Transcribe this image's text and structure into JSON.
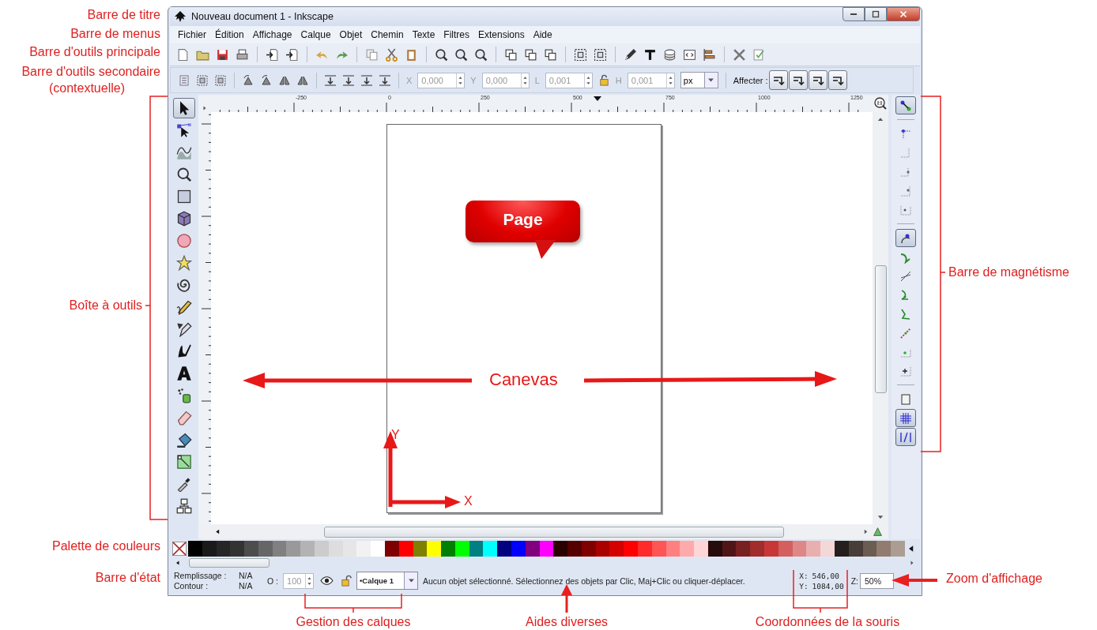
{
  "window": {
    "title": "Nouveau document 1 - Inkscape"
  },
  "menu": [
    {
      "label": "Fichier"
    },
    {
      "label": "Édition"
    },
    {
      "label": "Affichage"
    },
    {
      "label": "Calque"
    },
    {
      "label": "Objet"
    },
    {
      "label": "Chemin"
    },
    {
      "label": "Texte"
    },
    {
      "label": "Filtres"
    },
    {
      "label": "Extensions"
    },
    {
      "label": "Aide"
    }
  ],
  "tool_controls": {
    "fields": [
      {
        "label": "X",
        "value": "0,000",
        "disabled": true
      },
      {
        "label": "Y",
        "value": "0,000",
        "disabled": true
      },
      {
        "label": "L",
        "value": "0,001",
        "disabled": true
      },
      {
        "label": "H",
        "value": "0,001",
        "disabled": true
      }
    ],
    "unit": "px",
    "affect_label": "Affecter :"
  },
  "toolbox": {
    "tools": [
      {
        "kind": "selector",
        "selected": true
      },
      {
        "kind": "node",
        "selected": false
      },
      {
        "kind": "tweak",
        "selected": false
      },
      {
        "kind": "zoom",
        "selected": false
      },
      {
        "kind": "rect",
        "selected": false
      },
      {
        "kind": "box3d",
        "selected": false
      },
      {
        "kind": "circle",
        "selected": false
      },
      {
        "kind": "star",
        "selected": false
      },
      {
        "kind": "spiral",
        "selected": false
      },
      {
        "kind": "pencil",
        "selected": false
      },
      {
        "kind": "pen",
        "selected": false
      },
      {
        "kind": "calligraphy",
        "selected": false
      },
      {
        "kind": "text",
        "selected": false
      },
      {
        "kind": "spray",
        "selected": false
      },
      {
        "kind": "eraser",
        "selected": false
      },
      {
        "kind": "bucket",
        "selected": false
      },
      {
        "kind": "gradient",
        "selected": false
      },
      {
        "kind": "dropper",
        "selected": false
      },
      {
        "kind": "connector",
        "selected": false
      }
    ]
  },
  "ruler_labels": [
    "-250",
    "0",
    "250",
    "500",
    "750",
    "1000",
    "1250"
  ],
  "canvas": {
    "page_label": "Page",
    "canvas_label": "Canevas",
    "axis_y": "Y",
    "axis_x": "X"
  },
  "snap_bar": {
    "items": [
      {
        "kind": "toggle",
        "selected": true
      },
      {
        "kind": "bbox",
        "selected": false
      },
      {
        "kind": "bbox-edge",
        "selected": false
      },
      {
        "kind": "bbox-corner",
        "selected": false
      },
      {
        "kind": "bbox-midpoint",
        "selected": false
      },
      {
        "kind": "bbox-center",
        "selected": false
      },
      {
        "kind": "nodes",
        "selected": true
      },
      {
        "kind": "path",
        "selected": false
      },
      {
        "kind": "intersection",
        "selected": false
      },
      {
        "kind": "smooth",
        "selected": false
      },
      {
        "kind": "cusp",
        "selected": false
      },
      {
        "kind": "midpoint",
        "selected": false
      },
      {
        "kind": "object-center",
        "selected": false
      },
      {
        "kind": "rotation-center",
        "selected": false
      },
      {
        "kind": "page",
        "selected": false
      },
      {
        "kind": "grid",
        "selected": true
      },
      {
        "kind": "guide",
        "selected": true
      }
    ]
  },
  "palette": [
    {
      "color": "#000000"
    },
    {
      "color": "#1a1a1a"
    },
    {
      "color": "#262626"
    },
    {
      "color": "#333333"
    },
    {
      "color": "#4d4d4d"
    },
    {
      "color": "#666666"
    },
    {
      "color": "#808080"
    },
    {
      "color": "#999999"
    },
    {
      "color": "#b3b3b3"
    },
    {
      "color": "#cccccc"
    },
    {
      "color": "#dddddd"
    },
    {
      "color": "#e6e6e6"
    },
    {
      "color": "#f2f2f2"
    },
    {
      "color": "#ffffff"
    },
    {
      "color": "#800000"
    },
    {
      "color": "#ff0000"
    },
    {
      "color": "#808000"
    },
    {
      "color": "#ffff00"
    },
    {
      "color": "#008000"
    },
    {
      "color": "#00ff00"
    },
    {
      "color": "#008080"
    },
    {
      "color": "#00ffff"
    },
    {
      "color": "#000080"
    },
    {
      "color": "#0000ff"
    },
    {
      "color": "#800080"
    },
    {
      "color": "#ff00ff"
    },
    {
      "color": "#2b0000"
    },
    {
      "color": "#550000"
    },
    {
      "color": "#800000"
    },
    {
      "color": "#aa0000"
    },
    {
      "color": "#d40000"
    },
    {
      "color": "#ff0000"
    },
    {
      "color": "#ff2a2a"
    },
    {
      "color": "#ff5555"
    },
    {
      "color": "#ff8080"
    },
    {
      "color": "#ffaaaa"
    },
    {
      "color": "#ffd5d5"
    },
    {
      "color": "#280b0b"
    },
    {
      "color": "#501616"
    },
    {
      "color": "#782121"
    },
    {
      "color": "#a02c2c"
    },
    {
      "color": "#c83737"
    },
    {
      "color": "#d35f5f"
    },
    {
      "color": "#de8787"
    },
    {
      "color": "#e9afaf"
    },
    {
      "color": "#f4d7d7"
    },
    {
      "color": "#241f1c"
    },
    {
      "color": "#483e37"
    },
    {
      "color": "#6c5d53"
    },
    {
      "color": "#917c6f"
    },
    {
      "color": "#ac9d93"
    }
  ],
  "status": {
    "fill_label": "Remplissage :",
    "fill_value": "N/A",
    "stroke_label": "Contour :",
    "stroke_value": "N/A",
    "opacity_label": "O :",
    "opacity_value": "100",
    "opacity_disabled": true,
    "layer": "•Calque 1",
    "message": "Aucun objet sélectionné. Sélectionnez des objets par Clic, Maj+Clic ou cliquer-déplacer.",
    "x_label": "X:",
    "x_value": "546,00",
    "y_label": "Y:",
    "y_value": "1084,00",
    "zoom_label": "Z:",
    "zoom_value": "50%"
  },
  "annotations": {
    "left": [
      "Barre de titre",
      "Barre de menus",
      "Barre d'outils principale",
      "Barre d'outils secondaire",
      "(contextuelle)",
      "Boîte à outils",
      "Palette de couleurs",
      "Barre d'état"
    ],
    "right": [
      "Barre de magnétisme",
      "Zoom d'affichage"
    ],
    "bottom": [
      "Gestion des calques",
      "Aides diverses",
      "Coordonnées de la souris"
    ]
  }
}
